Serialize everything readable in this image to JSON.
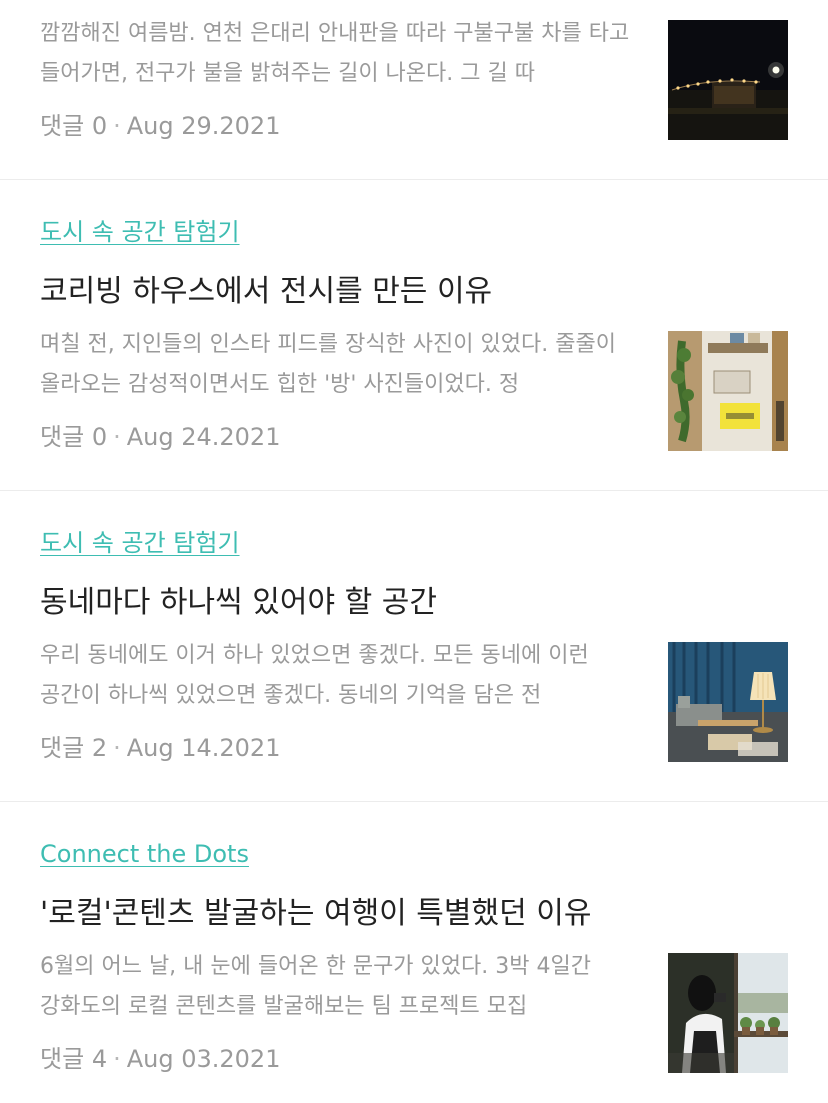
{
  "posts": [
    {
      "category": "",
      "title": "",
      "excerpt": "깜깜해진 여름밤. 연천 은대리 안내판을 따라 구불구불 차를 타고 들어가면, 전구가 불을 밝혀주는 길이 나온다.  그 길 따",
      "comments_label": "댓글",
      "comments_count": "0",
      "date": "Aug 29.2021",
      "thumbnail": "night-cabin-string-lights-photo"
    },
    {
      "category": "도시 속 공간 탐험기",
      "title": "코리빙 하우스에서 전시를 만든 이유",
      "excerpt": "며칠 전, 지인들의 인스타 피드를 장식한 사진이 있었다. 줄줄이 올라오는 감성적이면서도 힙한 '방' 사진들이었다. 정",
      "comments_label": "댓글",
      "comments_count": "0",
      "date": "Aug 24.2021",
      "thumbnail": "room-exhibition-plants-photo"
    },
    {
      "category": "도시 속 공간 탐험기",
      "title": "동네마다 하나씩 있어야 할 공간",
      "excerpt": "우리 동네에도 이거 하나 있었으면 좋겠다. 모든 동네에 이런 공간이 하나씩 있었으면 좋겠다.  동네의 기억을 담은 전",
      "comments_label": "댓글",
      "comments_count": "2",
      "date": "Aug 14.2021",
      "thumbnail": "lounge-blue-curtain-lamp-photo"
    },
    {
      "category": "Connect the Dots",
      "title": "'로컬'콘텐츠 발굴하는 여행이 특별했던 이유",
      "excerpt": "6월의 어느 날, 내 눈에 들어온 한 문구가 있었다.  3박 4일간 강화도의 로컬 콘텐츠를 발굴해보는 팀 프로젝트 모집",
      "comments_label": "댓글",
      "comments_count": "4",
      "date": "Aug 03.2021",
      "thumbnail": "woman-at-window-camera-photo"
    }
  ],
  "colors": {
    "category": "#3ebdb2",
    "title": "#222222",
    "muted": "#9a9a9a",
    "divider": "#ececec"
  }
}
